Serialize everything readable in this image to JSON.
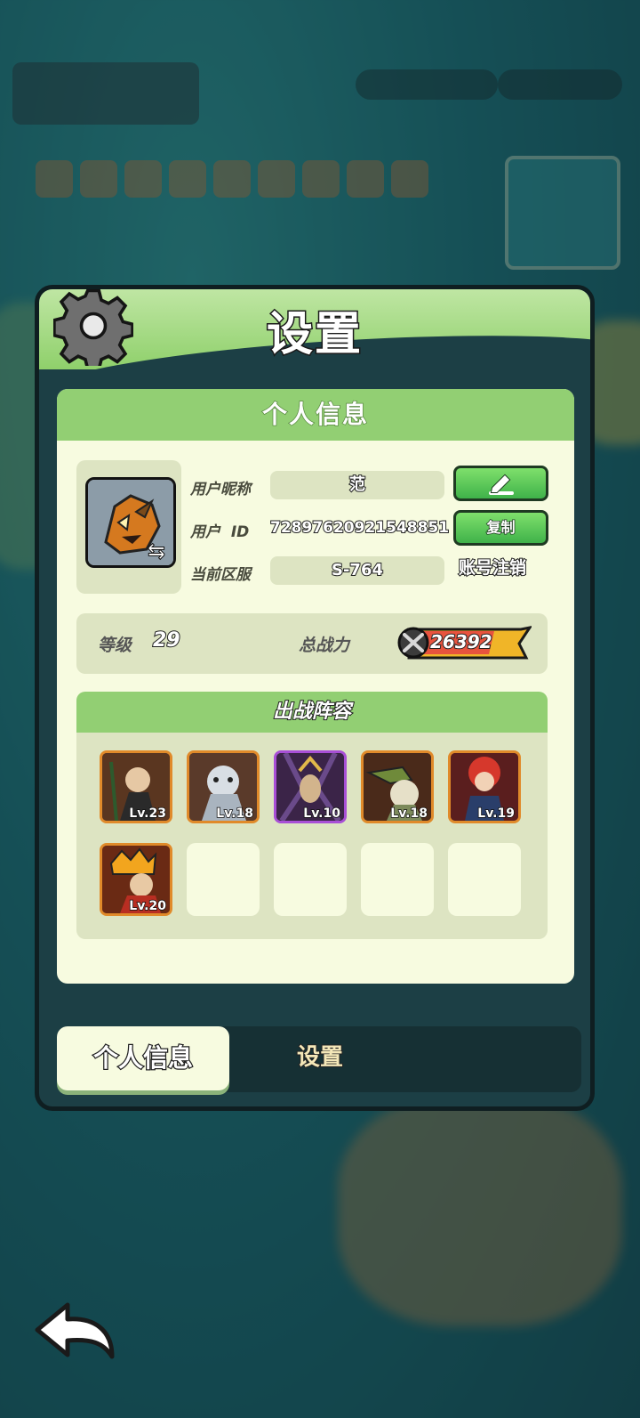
{
  "panel": {
    "title": "设置"
  },
  "profile": {
    "section_title": "个人信息",
    "nickname_label": "用户昵称",
    "nickname": "范",
    "id_label": "用户  ID",
    "user_id": "7289762092154885",
    "id_suffix": "1",
    "server_label": "当前区服",
    "server": "S-764",
    "copy_label": "复制",
    "cancel_account_label": "账号注销",
    "level_label": "等级",
    "level": "29",
    "power_label": "总战力",
    "power": "26392"
  },
  "lineup": {
    "title": "出战阵容",
    "heroes": [
      {
        "level": "Lv.23",
        "rarity": "legend"
      },
      {
        "level": "Lv.18",
        "rarity": "legend"
      },
      {
        "level": "Lv.10",
        "rarity": "epic"
      },
      {
        "level": "Lv.18",
        "rarity": "legend"
      },
      {
        "level": "Lv.19",
        "rarity": "legend"
      },
      {
        "level": "Lv.20",
        "rarity": "legend"
      }
    ],
    "empty_slots": 4
  },
  "tabs": {
    "active": "个人信息",
    "other": "设置"
  },
  "colors": {
    "accent_green": "#92cf73",
    "panel_dark": "#1c3f45",
    "card_bg": "#f7fbe0",
    "button_green": "#3fb24a"
  },
  "icons": [
    "gear-icon",
    "edit-icon",
    "swap-icon",
    "power-icon",
    "back-arrow-icon"
  ]
}
